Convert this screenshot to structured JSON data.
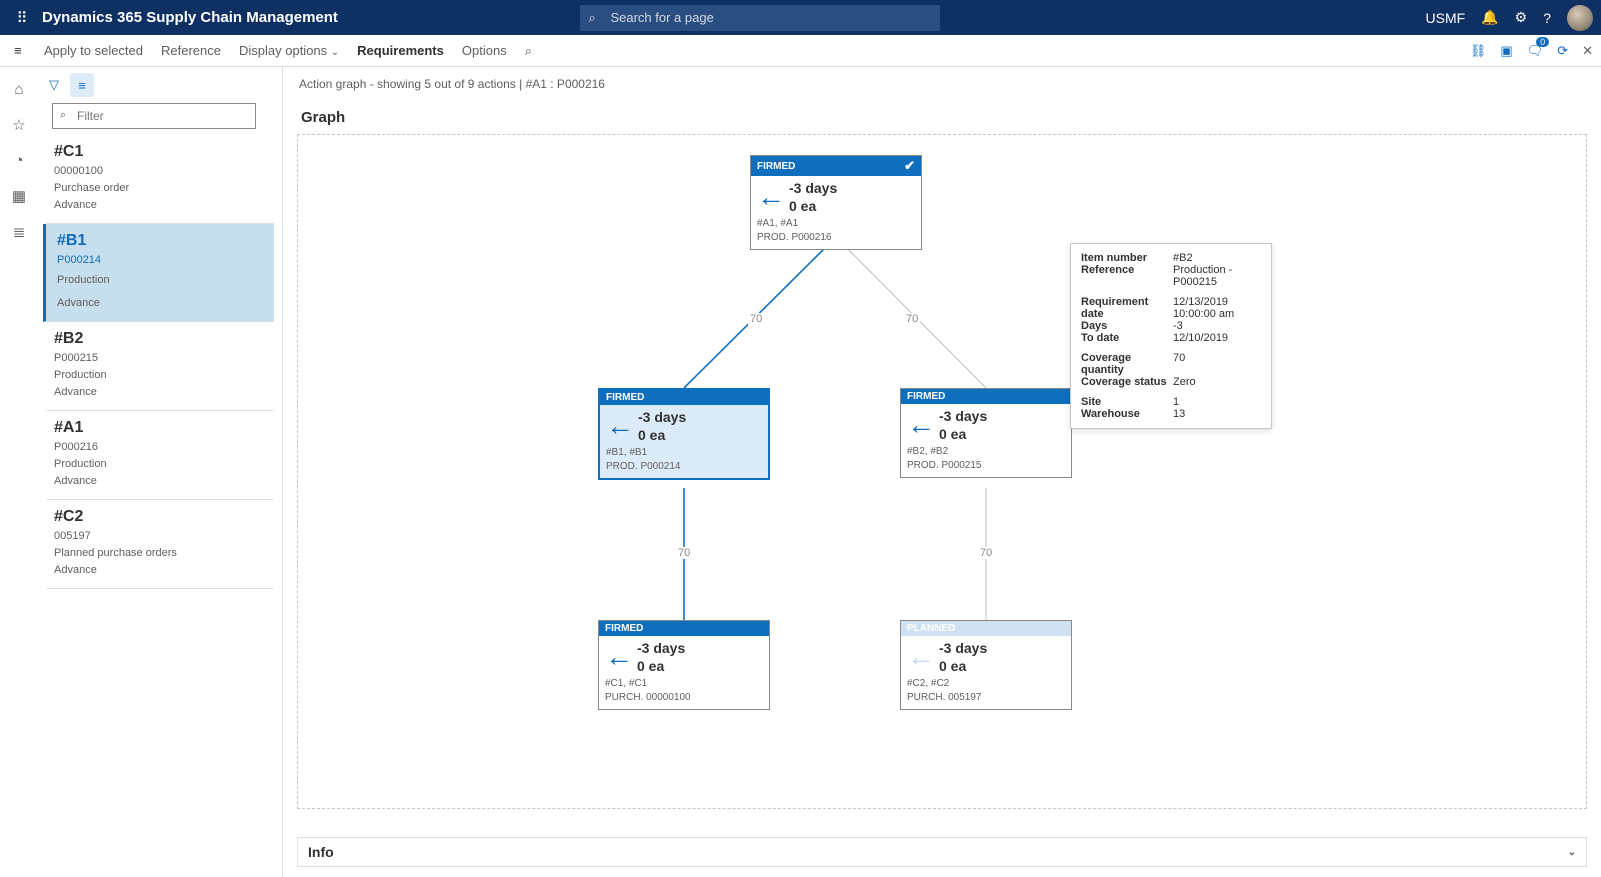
{
  "topbar": {
    "title": "Dynamics 365 Supply Chain Management",
    "search_placeholder": "Search for a page",
    "entity": "USMF"
  },
  "cmdbar": {
    "apply": "Apply to selected",
    "reference": "Reference",
    "display": "Display options",
    "requirements": "Requirements",
    "options": "Options"
  },
  "sidebar": {
    "filter_placeholder": "Filter",
    "items": [
      {
        "code": "#C1",
        "num": "00000100",
        "type": "Purchase order",
        "action": "Advance"
      },
      {
        "code": "#B1",
        "num": "P000214",
        "type": "Production",
        "action": "Advance"
      },
      {
        "code": "#B2",
        "num": "P000215",
        "type": "Production",
        "action": "Advance"
      },
      {
        "code": "#A1",
        "num": "P000216",
        "type": "Production",
        "action": "Advance"
      },
      {
        "code": "#C2",
        "num": "005197",
        "type": "Planned purchase orders",
        "action": "Advance"
      }
    ]
  },
  "breadcrumb": "Action graph - showing 5 out of 9 actions   |   #A1 : P000216",
  "panel_title": "Graph",
  "nodes": {
    "a1": {
      "status": "FIRMED",
      "days": "-3 days",
      "qty": "0 ea",
      "refs": "#A1, #A1",
      "doc": "PROD. P000216",
      "chk": true
    },
    "b1": {
      "status": "FIRMED",
      "days": "-3 days",
      "qty": "0 ea",
      "refs": "#B1, #B1",
      "doc": "PROD. P000214"
    },
    "b2": {
      "status": "FIRMED",
      "days": "-3 days",
      "qty": "0 ea",
      "refs": "#B2, #B2",
      "doc": "PROD. P000215"
    },
    "c1": {
      "status": "FIRMED",
      "days": "-3 days",
      "qty": "0 ea",
      "refs": "#C1, #C1",
      "doc": "PURCH. 00000100"
    },
    "c2": {
      "status": "PLANNED",
      "days": "-3 days",
      "qty": "0 ea",
      "refs": "#C2, #C2",
      "doc": "PURCH. 005197"
    }
  },
  "edges": {
    "e1": "70",
    "e2": "70",
    "e3": "70",
    "e4": "70"
  },
  "tooltip": {
    "rows": [
      {
        "k": "Item number",
        "v": "#B2"
      },
      {
        "k": "Reference",
        "v": "Production - P000215"
      }
    ],
    "rows2": [
      {
        "k": "Requirement date",
        "v": "12/13/2019 10:00:00 am"
      },
      {
        "k": "Days",
        "v": "-3"
      },
      {
        "k": "To date",
        "v": "12/10/2019"
      }
    ],
    "rows3": [
      {
        "k": "Coverage quantity",
        "v": "70"
      },
      {
        "k": "Coverage status",
        "v": "Zero"
      }
    ],
    "rows4": [
      {
        "k": "Site",
        "v": "1"
      },
      {
        "k": "Warehouse",
        "v": "13"
      }
    ]
  },
  "info_title": "Info"
}
